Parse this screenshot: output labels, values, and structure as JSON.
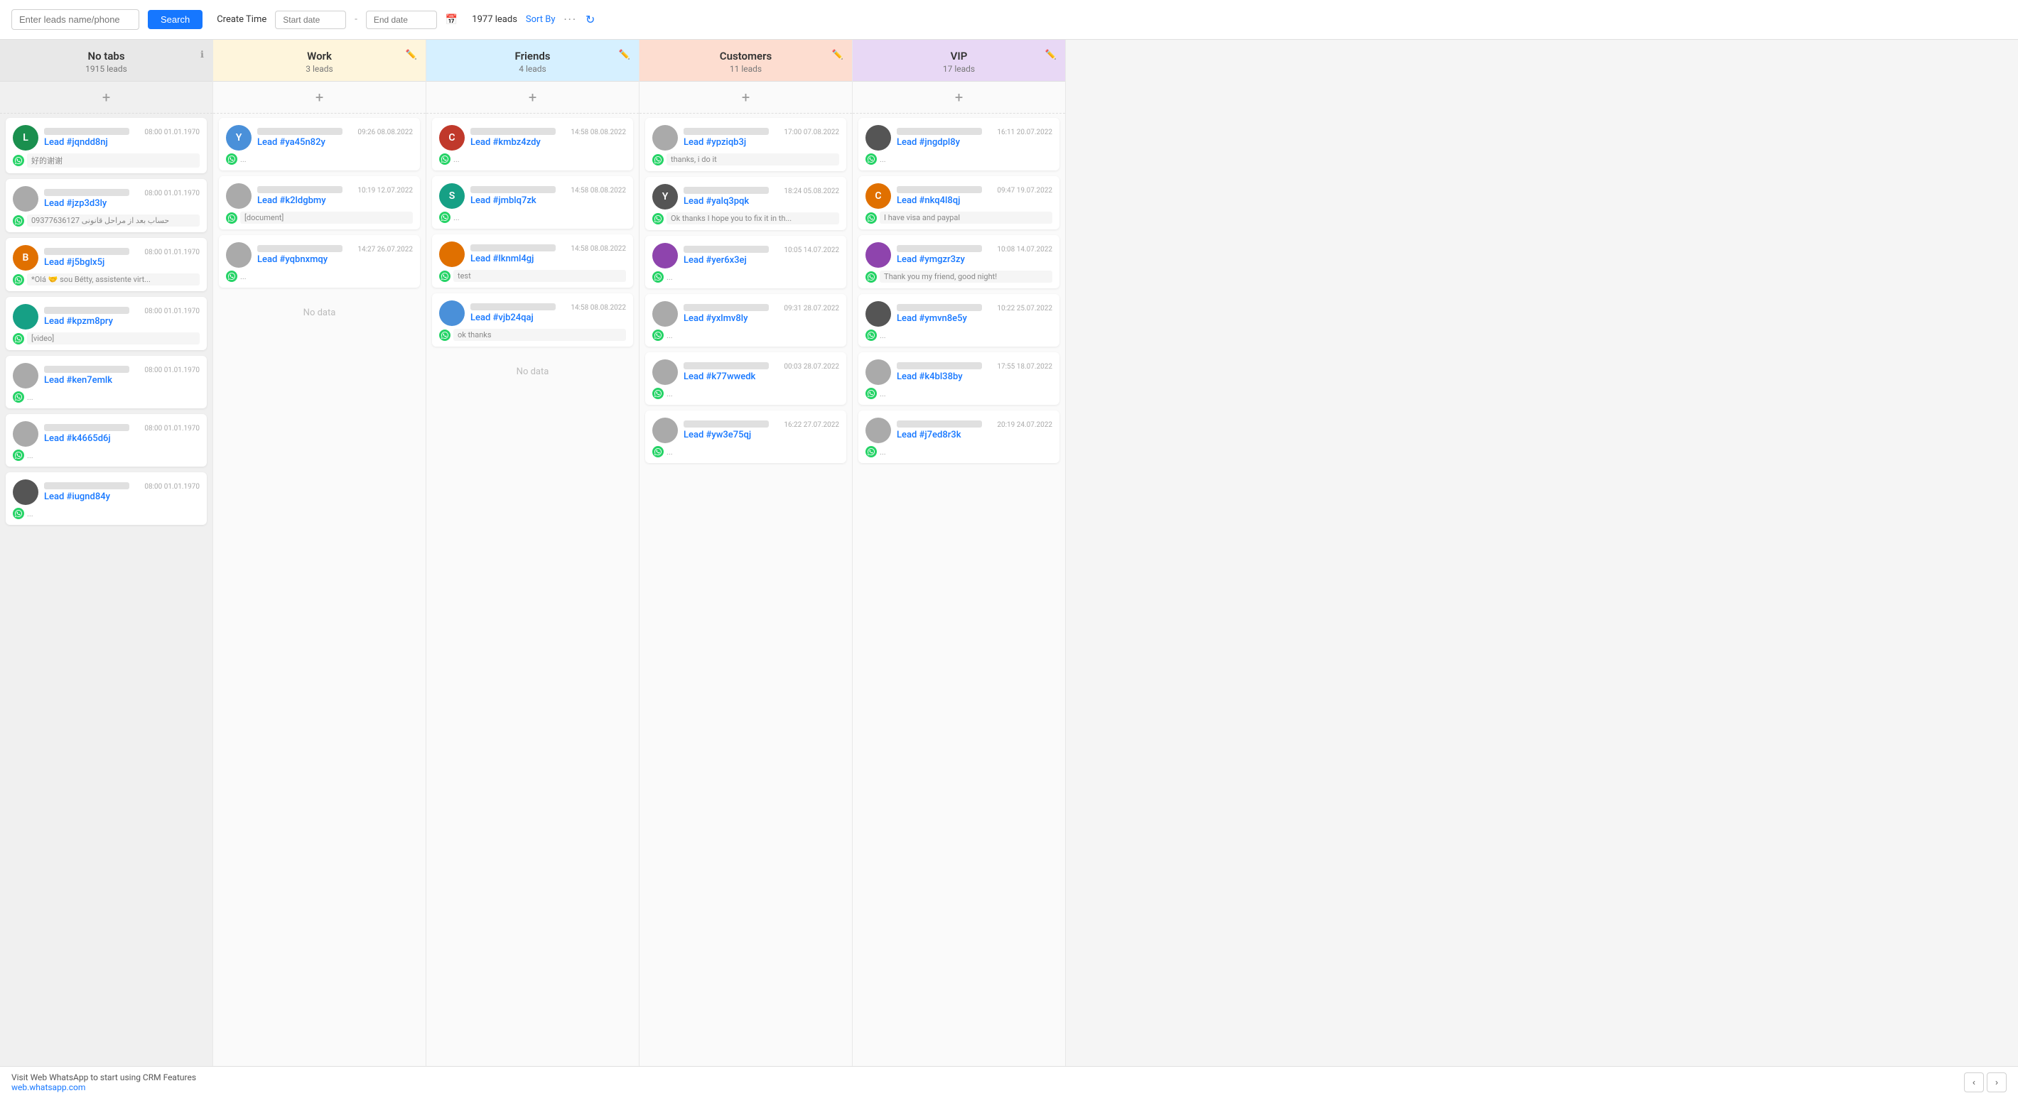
{
  "topbar": {
    "search_placeholder": "Enter leads name/phone",
    "search_label": "Search",
    "create_time_label": "Create Time",
    "start_date_placeholder": "Start date",
    "end_date_placeholder": "End date",
    "leads_count": "1977 leads",
    "sort_by_label": "Sort By",
    "footer_text": "Visit Web WhatsApp to start using CRM Features",
    "footer_link": "web.whatsapp.com"
  },
  "columns": [
    {
      "id": "notabs",
      "title": "No tabs",
      "leads": "1915 leads",
      "colorClass": "col-notabs",
      "cards": [
        {
          "id": "jqndd8nj",
          "time": "08:00 01.01.1970",
          "msg": "好的谢谢",
          "hasMsg": true,
          "avatarColor": "av-green",
          "avatarLetter": "L"
        },
        {
          "id": "jzp3d3ly",
          "time": "08:00 01.01.1970",
          "msg": "09377636127 حساب بعد از مراحل قانونی",
          "hasMsg": true,
          "avatarColor": "av-gray",
          "avatarLetter": ""
        },
        {
          "id": "j5bglx5j",
          "time": "08:00 01.01.1970",
          "msg": "*Olá 🤝 sou Bétty, assistente virt...",
          "hasMsg": true,
          "avatarColor": "av-orange",
          "avatarLetter": "B"
        },
        {
          "id": "kpzm8pry",
          "time": "08:00 01.01.1970",
          "msg": "[video]",
          "hasMsg": true,
          "avatarColor": "av-teal",
          "avatarLetter": ""
        },
        {
          "id": "ken7emlk",
          "time": "08:00 01.01.1970",
          "msg": "...",
          "hasMsg": false,
          "avatarColor": "av-gray",
          "avatarLetter": ""
        },
        {
          "id": "k4665d6j",
          "time": "08:00 01.01.1970",
          "msg": "...",
          "hasMsg": false,
          "avatarColor": "av-gray",
          "avatarLetter": ""
        },
        {
          "id": "iugnd84y",
          "time": "08:00 01.01.1970",
          "msg": "...",
          "hasMsg": false,
          "avatarColor": "av-dark",
          "avatarLetter": ""
        }
      ]
    },
    {
      "id": "work",
      "title": "Work",
      "leads": "3 leads",
      "colorClass": "col-work",
      "cards": [
        {
          "id": "ya45n82y",
          "time": "09:26 08.08.2022",
          "msg": "...",
          "hasMsg": false,
          "avatarColor": "av-blue",
          "avatarLetter": "Y"
        },
        {
          "id": "k2ldgbmy",
          "time": "10:19 12.07.2022",
          "msg": "[document]",
          "hasMsg": true,
          "avatarColor": "av-gray",
          "avatarLetter": ""
        },
        {
          "id": "yqbnxmqy",
          "time": "14:27 26.07.2022",
          "msg": "...",
          "hasMsg": false,
          "avatarColor": "av-gray",
          "avatarLetter": ""
        }
      ],
      "noData": true
    },
    {
      "id": "friends",
      "title": "Friends",
      "leads": "4 leads",
      "colorClass": "col-friends",
      "cards": [
        {
          "id": "kmbz4zdy",
          "time": "14:58 08.08.2022",
          "msg": "...",
          "hasMsg": false,
          "avatarColor": "av-red",
          "avatarLetter": "C"
        },
        {
          "id": "jmblq7zk",
          "time": "14:58 08.08.2022",
          "msg": "...",
          "hasMsg": false,
          "avatarColor": "av-teal",
          "avatarLetter": "S"
        },
        {
          "id": "lknml4gj",
          "time": "14:58 08.08.2022",
          "msg": "test",
          "hasMsg": true,
          "avatarColor": "av-orange",
          "avatarLetter": ""
        },
        {
          "id": "vjb24qaj",
          "time": "14:58 08.08.2022",
          "msg": "ok thanks",
          "hasMsg": true,
          "avatarColor": "av-blue",
          "avatarLetter": ""
        }
      ],
      "noData": true
    },
    {
      "id": "customers",
      "title": "Customers",
      "leads": "11 leads",
      "colorClass": "col-customers",
      "cards": [
        {
          "id": "ypziqb3j",
          "time": "17:00 07.08.2022",
          "msg": "thanks, i do it",
          "hasMsg": true,
          "avatarColor": "av-gray",
          "avatarLetter": ""
        },
        {
          "id": "yalq3pqk",
          "time": "18:24 05.08.2022",
          "msg": "Ok thanks I hope you to fix it in th...",
          "hasMsg": true,
          "avatarColor": "av-dark",
          "avatarLetter": "Y"
        },
        {
          "id": "yer6x3ej",
          "time": "10:05 14.07.2022",
          "msg": "...",
          "hasMsg": false,
          "avatarColor": "av-purple",
          "avatarLetter": ""
        },
        {
          "id": "yxlmv8ly",
          "time": "09:31 28.07.2022",
          "msg": "...",
          "hasMsg": false,
          "avatarColor": "av-gray",
          "avatarLetter": ""
        },
        {
          "id": "k77wwedk",
          "time": "00:03 28.07.2022",
          "msg": "...",
          "hasMsg": false,
          "avatarColor": "av-gray",
          "avatarLetter": ""
        },
        {
          "id": "yw3e75qj",
          "time": "16:22 27.07.2022",
          "msg": "...",
          "hasMsg": false,
          "avatarColor": "av-gray",
          "avatarLetter": ""
        }
      ]
    },
    {
      "id": "vip",
      "title": "VIP",
      "leads": "17 leads",
      "colorClass": "col-vip",
      "cards": [
        {
          "id": "jngdpl8y",
          "time": "16:11 20.07.2022",
          "msg": "...",
          "hasMsg": false,
          "avatarColor": "av-dark",
          "avatarLetter": ""
        },
        {
          "id": "nkq4l8qj",
          "time": "09:47 19.07.2022",
          "msg": "I have visa and paypal",
          "hasMsg": true,
          "avatarColor": "av-orange",
          "avatarLetter": "C"
        },
        {
          "id": "ymgzr3zy",
          "time": "10:08 14.07.2022",
          "msg": "Thank you my friend, good night!",
          "hasMsg": true,
          "avatarColor": "av-purple",
          "avatarLetter": ""
        },
        {
          "id": "ymvn8e5y",
          "time": "10:22 25.07.2022",
          "msg": "...",
          "hasMsg": false,
          "avatarColor": "av-dark",
          "avatarLetter": ""
        },
        {
          "id": "k4bl38by",
          "time": "17:55 18.07.2022",
          "msg": "...",
          "hasMsg": false,
          "avatarColor": "av-gray",
          "avatarLetter": ""
        },
        {
          "id": "j7ed8r3k",
          "time": "20:19 24.07.2022",
          "msg": "...",
          "hasMsg": false,
          "avatarColor": "av-gray",
          "avatarLetter": ""
        }
      ]
    }
  ]
}
